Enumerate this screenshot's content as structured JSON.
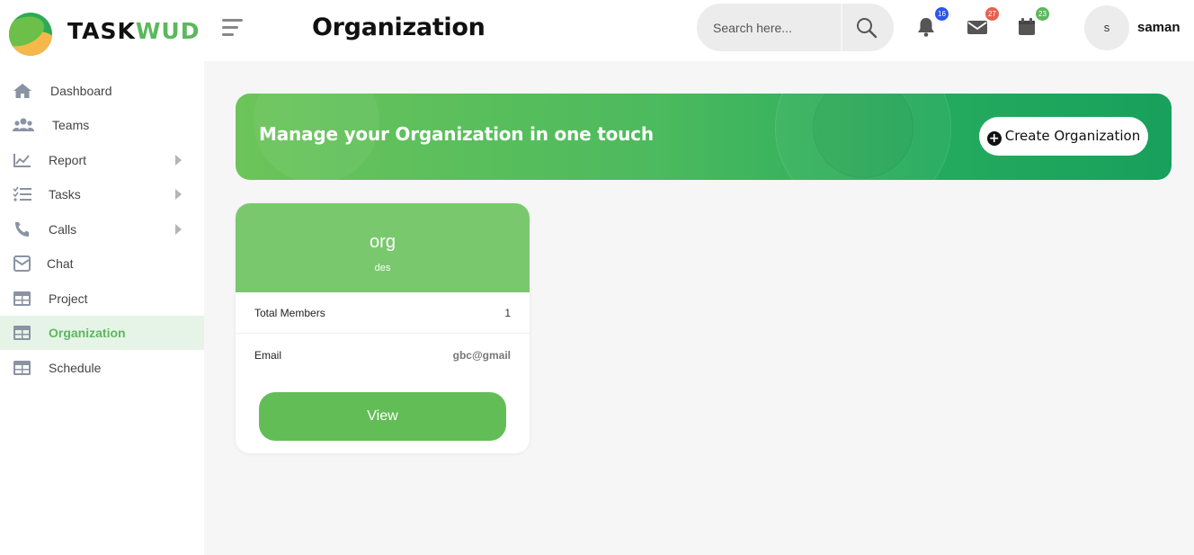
{
  "brand": {
    "part1": "TASK",
    "part2": "WUD"
  },
  "header": {
    "title": "Organization",
    "search": {
      "placeholder": "Search here..."
    },
    "notifications": {
      "count": "16",
      "color": "#2d55e8"
    },
    "messages": {
      "count": "27",
      "color": "#e8604c"
    },
    "calendar": {
      "count": "23",
      "color": "#5cb85c"
    },
    "user": {
      "initial": "s",
      "name": "saman"
    }
  },
  "sidebar": {
    "items": [
      {
        "label": "Dashboard",
        "icon": "home-icon"
      },
      {
        "label": "Teams",
        "icon": "users-icon"
      },
      {
        "label": "Report",
        "icon": "chart-line-icon",
        "has_submenu": true
      },
      {
        "label": "Tasks",
        "icon": "checklist-icon",
        "has_submenu": true
      },
      {
        "label": "Calls",
        "icon": "phone-icon",
        "has_submenu": true
      },
      {
        "label": "Chat",
        "icon": "envelope-icon"
      },
      {
        "label": "Project",
        "icon": "table-icon"
      },
      {
        "label": "Organization",
        "icon": "table-icon",
        "active": true
      },
      {
        "label": "Schedule",
        "icon": "table-icon"
      }
    ]
  },
  "banner": {
    "text": "Manage your Organization in one touch",
    "button_label": "Create Organization"
  },
  "org_card": {
    "name": "org",
    "description": "des",
    "members_label": "Total Members",
    "members_value": "1",
    "email_label": "Email",
    "email_value": "gbc@gmail",
    "view_label": "View"
  },
  "colors": {
    "accent": "#5cb85c",
    "banner_start": "#6cc45a",
    "banner_end": "#18a05c",
    "card_header": "#7ac86e",
    "view_button": "#63bd57"
  }
}
